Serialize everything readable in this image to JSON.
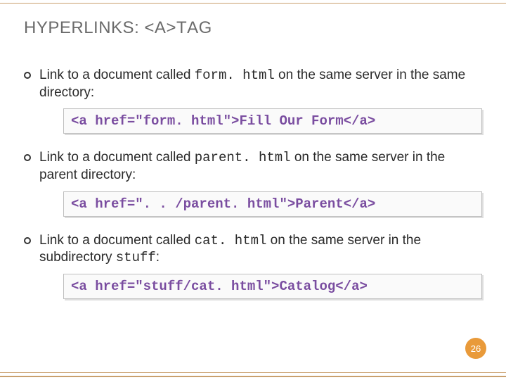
{
  "title": {
    "prefix": "H",
    "word1": "YPERLINKS",
    "sep": ": <",
    "mid": "A",
    "after": ">T",
    "suffix": "AG"
  },
  "items": [
    {
      "t1": "Link to a document called ",
      "code": "form. html",
      "t2": " on the same server in the same directory:",
      "box": "<a href=\"form. html\">Fill Our Form</a>"
    },
    {
      "t1": "Link to a document called ",
      "code": "parent. html",
      "t2": " on the same server in the parent directory:",
      "box": "<a href=\". . /parent. html\">Parent</a>"
    },
    {
      "t1": "Link to a document called ",
      "code": "cat. html",
      "t2": " on the same server in the subdirectory ",
      "code2": "stuff",
      "t3": ":",
      "box": "<a href=\"stuff/cat. html\">Catalog</a>"
    }
  ],
  "page": "26"
}
